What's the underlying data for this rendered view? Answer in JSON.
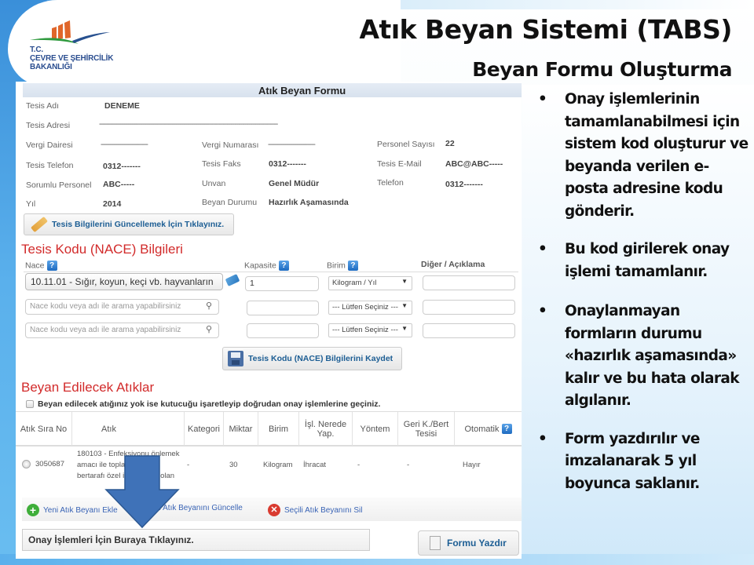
{
  "slide": {
    "title": "Atık Beyan Sistemi (TABS)",
    "subtitle": "Beyan Formu Oluşturma",
    "logo": {
      "icon": "ministry-logo-icon",
      "line1": "T.C.",
      "line2": "ÇEVRE VE ŞEHİRCİLİK",
      "line3": "BAKANLIĞI"
    },
    "bullets": [
      "Onay işlemlerinin tamamlanabilmesi için sistem kod oluşturur ve beyanda verilen e-posta adresine kodu gönderir.",
      "Bu kod girilerek onay işlemi tamamlanır.",
      "Onaylanmayan formların durumu «hazırlık aşamasında» kalır ve bu hata olarak algılanır.",
      "Form yazdırılır ve imzalanarak 5 yıl boyunca saklanır."
    ],
    "bullet_glyph": "•",
    "colors": {
      "section_red": "#d22b2b",
      "link_blue": "#1d5e94",
      "arrow_blue": "#3f72b8"
    }
  },
  "form": {
    "header": "Atık Beyan Formu",
    "facility": {
      "tesis_adi": {
        "label": "Tesis Adı",
        "value": "DENEME"
      },
      "tesis_adresi": {
        "label": "Tesis Adresi",
        "value": "-------------------------------------------------------------------------------------------"
      },
      "vergi_dairesi": {
        "label": "Vergi Dairesi",
        "value": "------------------------"
      },
      "vergi_numarasi": {
        "label": "Vergi Numarası",
        "value": "------------------------"
      },
      "personel_sayisi": {
        "label": "Personel Sayısı",
        "value": "22"
      },
      "tesis_telefon": {
        "label": "Tesis Telefon",
        "value": "0312-------"
      },
      "tesis_faks": {
        "label": "Tesis Faks",
        "value": "0312-------"
      },
      "tesis_email": {
        "label": "Tesis E-Mail",
        "value": "ABC@ABC-----"
      },
      "sorumlu_personel": {
        "label": "Sorumlu Personel",
        "value": "ABC-----"
      },
      "unvan": {
        "label": "Unvan",
        "value": "Genel Müdür"
      },
      "telefon": {
        "label": "Telefon",
        "value": "0312-------"
      },
      "yil": {
        "label": "Yıl",
        "value": "2014"
      },
      "beyan_durumu": {
        "label": "Beyan Durumu",
        "value": "Hazırlık Aşamasında"
      }
    },
    "update_button": "Tesis Bilgilerini Güncellemek İçin Tıklayınız.",
    "nace_section": {
      "title": "Tesis Kodu (NACE) Bilgileri",
      "columns": {
        "nace": "Nace",
        "kapasite": "Kapasite",
        "birim": "Birim",
        "diger": "Diğer / Açıklama"
      },
      "help_glyph": "?",
      "rows": [
        {
          "nace": "10.11.01 - Sığır, koyun, keçi vb. hayvanların",
          "kapasite": "1",
          "birim": "Kilogram / Yıl",
          "diger": ""
        },
        {
          "nace": "",
          "nace_placeholder": "Nace kodu veya adı ile arama yapabilirsiniz",
          "kapasite": "",
          "birim": "--- Lütfen Seçiniz ---",
          "diger": ""
        },
        {
          "nace": "",
          "nace_placeholder": "Nace kodu veya adı ile arama yapabilirsiniz",
          "kapasite": "",
          "birim": "--- Lütfen Seçiniz ---",
          "diger": ""
        }
      ],
      "save_button": "Tesis Kodu (NACE) Bilgilerini Kaydet"
    },
    "waste_section": {
      "title": "Beyan Edilecek Atıklar",
      "no_waste_checkbox": "Beyan edilecek atığınız yok ise kutucuğu işaretleyip doğrudan onay işlemlerine geçiniz.",
      "columns": [
        "Atık Sıra No",
        "Atık",
        "Kategori",
        "Miktar",
        "Birim",
        "İşl. Nerede Yap.",
        "Yöntem",
        "Geri K./Bert Tesisi",
        "Otomatik"
      ],
      "rows": [
        {
          "sira_no": "3050687",
          "atik_line1": "180103 - Enfeksiyonu önlemek",
          "atik_line2": "amacı ile toplanması ve",
          "atik_line3": "bertarafı özel işleme tabi olan",
          "kategori": "-",
          "miktar": "30",
          "birim": "Kilogram",
          "islem_yeri": "İhracat",
          "yontem": "-",
          "tesis": "-",
          "otomatik": "Hayır"
        }
      ],
      "actions": {
        "add": "Yeni Atık Beyanı Ekle",
        "update": "Seçili Atık Beyanını Güncelle",
        "delete": "Seçili Atık Beyanını Sil"
      }
    },
    "approval_bar": "Onay İşlemleri İçin Buraya Tıklayınız.",
    "print_button": "Formu Yazdır"
  }
}
